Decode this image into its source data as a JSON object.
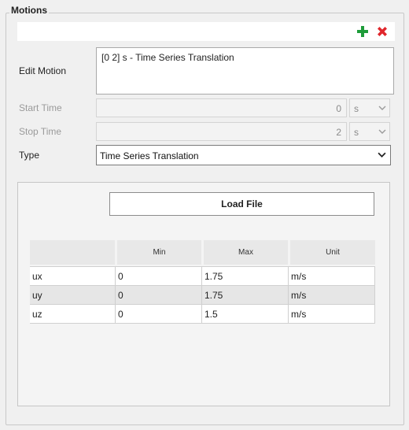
{
  "group": {
    "title": "Motions"
  },
  "toolbar": {
    "add_icon": "plus-icon",
    "delete_icon": "close-icon",
    "add_color": "#1e9c3a",
    "delete_color": "#e0262b"
  },
  "edit_motion": {
    "label": "Edit Motion",
    "value": "[0 2] s - Time Series Translation"
  },
  "start_time": {
    "label": "Start Time",
    "value": "0",
    "unit": "s"
  },
  "stop_time": {
    "label": "Stop Time",
    "value": "2",
    "unit": "s"
  },
  "type": {
    "label": "Type",
    "value": "Time Series Translation"
  },
  "load_file": {
    "label": "Load File"
  },
  "table": {
    "headers": [
      "",
      "Min",
      "Max",
      "Unit"
    ],
    "rows": [
      [
        "ux",
        "0",
        "1.75",
        "m/s"
      ],
      [
        "uy",
        "0",
        "1.75",
        "m/s"
      ],
      [
        "uz",
        "0",
        "1.5",
        "m/s"
      ]
    ]
  }
}
